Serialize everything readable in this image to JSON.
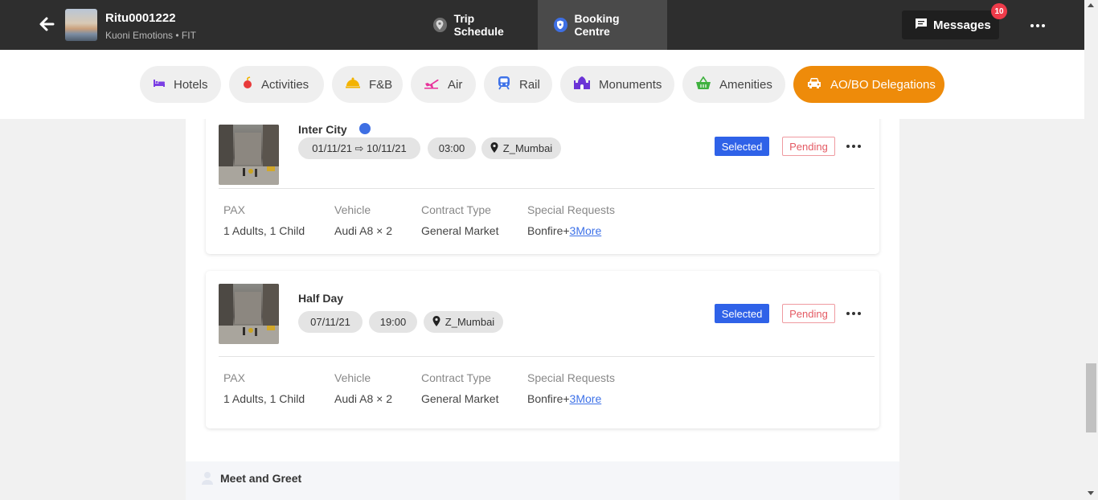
{
  "header": {
    "trip_id": "Ritu0001222",
    "subtitle": "Kuoni Emotions • FIT",
    "tabs": [
      {
        "label": "Trip Schedule",
        "active": false
      },
      {
        "label": "Booking Centre",
        "active": true
      }
    ],
    "messages_label": "Messages",
    "messages_count": "10"
  },
  "categories": [
    {
      "label": "Hotels",
      "icon": "bed-icon",
      "color": "#7b3fe4"
    },
    {
      "label": "Activities",
      "icon": "activity-icon",
      "color": "#e83a3a"
    },
    {
      "label": "F&B",
      "icon": "cloche-icon",
      "color": "#f3b300"
    },
    {
      "label": "Air",
      "icon": "plane-icon",
      "color": "#e8329b"
    },
    {
      "label": "Rail",
      "icon": "train-icon",
      "color": "#3e72e8"
    },
    {
      "label": "Monuments",
      "icon": "monument-icon",
      "color": "#6b33d6"
    },
    {
      "label": "Amenities",
      "icon": "basket-icon",
      "color": "#3fb13f"
    },
    {
      "label": "AO/BO Delegations",
      "icon": "car-icon",
      "color": "#ffffff",
      "active": true
    }
  ],
  "bookings": [
    {
      "title": "Inter City",
      "date": "01/11/21 ⇨ 10/11/21",
      "time": "03:00",
      "location": "Z_Mumbai",
      "status": "Selected",
      "approval": "Pending",
      "details": {
        "pax_label": "PAX",
        "pax_value": "1 Adults, 1 Child",
        "vehicle_label": "Vehicle",
        "vehicle_value": "Audi A8 × 2",
        "contract_label": "Contract Type",
        "contract_value": "General Market",
        "requests_label": "Special Requests",
        "requests_value": "Bonfire+",
        "requests_more": "3More"
      }
    },
    {
      "title": "Half Day",
      "date": "07/11/21",
      "time": "19:00",
      "location": "Z_Mumbai",
      "status": "Selected",
      "approval": "Pending",
      "details": {
        "pax_label": "PAX",
        "pax_value": "1 Adults, 1 Child",
        "vehicle_label": "Vehicle",
        "vehicle_value": "Audi A8 × 2",
        "contract_label": "Contract Type",
        "contract_value": "General Market",
        "requests_label": "Special Requests",
        "requests_value": "Bonfire+",
        "requests_more": "3More"
      }
    }
  ],
  "section": {
    "title": "Meet and Greet"
  },
  "colors": {
    "accent": "#ee8b0a",
    "selected": "#2f62e8",
    "pending": "#e45a63",
    "topbar": "#2e2e2e"
  }
}
